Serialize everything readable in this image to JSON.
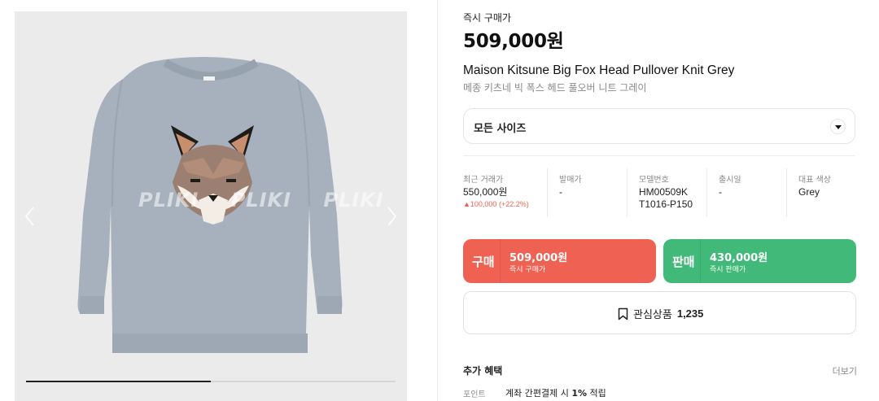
{
  "gallery": {
    "watermark": "PLIKI PLIKI PLIKI PLIKI",
    "prev_icon": "chevron-left-icon",
    "next_icon": "chevron-right-icon",
    "progress": 0.5
  },
  "product": {
    "price_label": "즉시 구매가",
    "price": "509,000원",
    "name_en": "Maison Kitsune Big Fox Head Pullover Knit Grey",
    "name_ko": "메종 키츠네 빅 폭스 헤드 풀오버 니트 그레이"
  },
  "size_select": {
    "label": "모든 사이즈",
    "icon": "caret-down-icon"
  },
  "stats": [
    {
      "key": "최근 거래가",
      "value": "550,000원",
      "delta": "▲100,000 (+22.2%)"
    },
    {
      "key": "발매가",
      "value": "-"
    },
    {
      "key": "모델번호",
      "value": "HM00509K",
      "value2": "T1016-P150"
    },
    {
      "key": "출시일",
      "value": "-"
    },
    {
      "key": "대표 색상",
      "value": "Grey"
    }
  ],
  "buy": {
    "title": "구매",
    "amount": "509,000원",
    "sub": "즉시 구매가",
    "color": "#ef6253"
  },
  "sell": {
    "title": "판매",
    "amount": "430,000원",
    "sub": "즉시 판매가",
    "color": "#41b979"
  },
  "wish": {
    "icon": "bookmark-icon",
    "label": "관심상품",
    "count": "1,235"
  },
  "benefits": {
    "title": "추가 혜택",
    "more": "더보기",
    "point_key": "포인트",
    "point_prefix": "계좌 간편결제 시 ",
    "point_bold": "1%",
    "point_suffix": " 적립"
  }
}
